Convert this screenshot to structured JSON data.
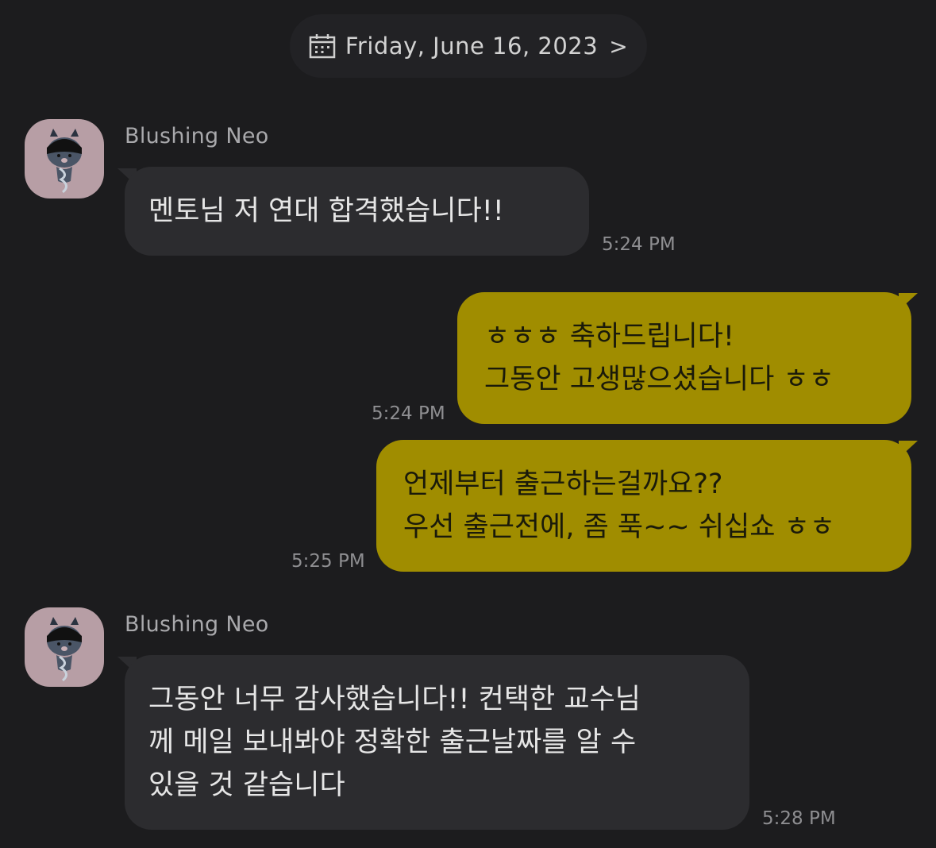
{
  "date_header": {
    "text": "Friday, June 16, 2023",
    "chevron": ">",
    "icon": "calendar-icon"
  },
  "messages": [
    {
      "direction": "incoming",
      "sender": "Blushing Neo",
      "text": "멘토님 저 연대 합격했습니다!!",
      "time": "5:24 PM"
    },
    {
      "direction": "outgoing",
      "text": "ㅎㅎㅎ 축하드립니다!\n그동안 고생많으셨습니다 ㅎㅎ",
      "time": "5:24 PM"
    },
    {
      "direction": "outgoing",
      "text": "언제부터 출근하는걸까요??\n우선 출근전에, 좀 푹~~ 쉬십쇼 ㅎㅎ",
      "time": "5:25 PM"
    },
    {
      "direction": "incoming",
      "sender": "Blushing Neo",
      "text": "그동안 너무 감사했습니다!! 컨택한 교수님\n께 메일 보내봐야 정확한 출근날짜를 알 수\n있을 것 같습니다",
      "time": "5:28 PM"
    }
  ],
  "colors": {
    "background": "#1c1c1e",
    "incoming_bubble": "#2c2c2f",
    "outgoing_bubble": "#a08d00",
    "avatar_bg": "#b79ea5"
  }
}
